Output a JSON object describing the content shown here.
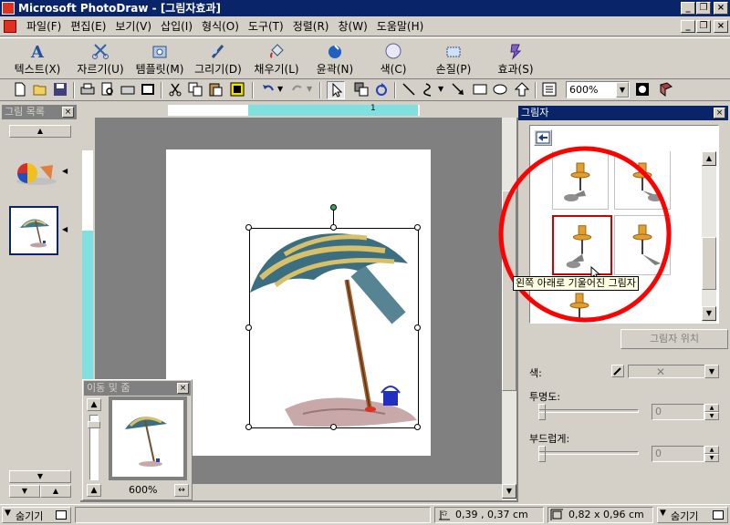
{
  "window": {
    "title": "Microsoft PhotoDraw - [그림자효과]"
  },
  "menu": {
    "items": [
      "파일(F)",
      "편집(E)",
      "보기(V)",
      "삽입(I)",
      "형식(O)",
      "도구(T)",
      "정렬(R)",
      "창(W)",
      "도움말(H)"
    ]
  },
  "toolbar": {
    "big_buttons": [
      "텍스트(X)",
      "자르기(U)",
      "템플릿(M)",
      "그리기(D)",
      "채우기(L)",
      "윤곽(N)",
      "색(C)",
      "손질(P)",
      "효과(S)"
    ],
    "zoom": "600%"
  },
  "picture_list": {
    "title": "그림 목록"
  },
  "pan_zoom": {
    "title": "이동 및 줌",
    "zoom": "600%"
  },
  "ruler": {
    "mark": "1"
  },
  "shadow_panel": {
    "title": "그림자",
    "tooltip": "왼쪽 아래로 기울어진 그림자",
    "position_button": "그림자 위치",
    "color_label": "색:",
    "transparency_label": "투명도:",
    "transparency_value": "0",
    "softness_label": "부드럽게:",
    "softness_value": "0"
  },
  "statusbar": {
    "hide_left": "숨기기",
    "position": "0,39 , 0,37 cm",
    "size": "0,82 x 0,96 cm",
    "hide_right": "숨기기"
  },
  "colors": {
    "title": "#0a246a",
    "face": "#d4d0c8",
    "canvas": "#808080",
    "highlight": "#cc0000",
    "annotation": "#ff0000"
  }
}
